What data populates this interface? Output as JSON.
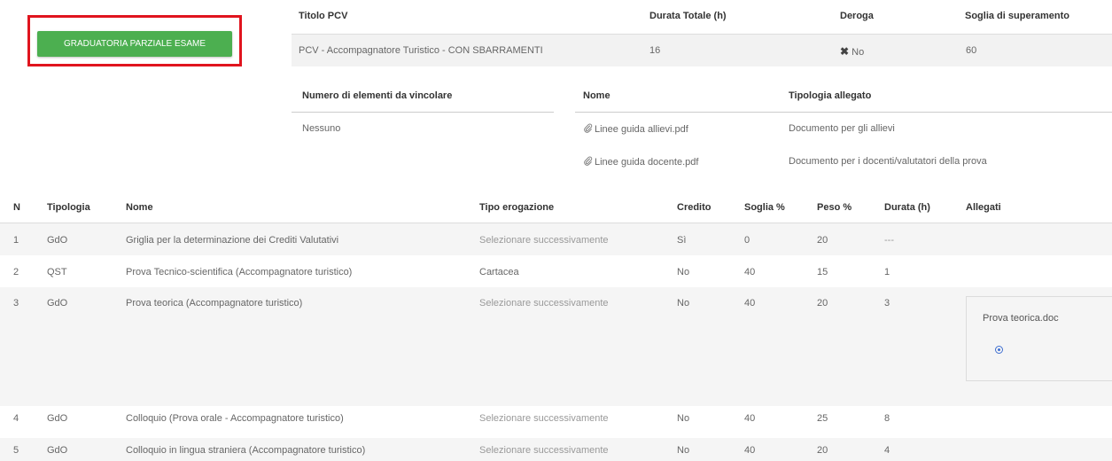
{
  "button": {
    "label": "GRADUATORIA PARZIALE ESAME"
  },
  "pcv": {
    "headers": {
      "title": "Titolo PCV",
      "duration": "Durata Totale (h)",
      "derogation": "Deroga",
      "threshold": "Soglia di superamento"
    },
    "row": {
      "title": "PCV - Accompagnatore Turistico - CON SBARRAMENTI",
      "duration": "16",
      "derogation": "No",
      "threshold": "60"
    }
  },
  "constraints": {
    "header": "Numero di elementi da vincolare",
    "value": "Nessuno"
  },
  "attachments": {
    "headers": {
      "name": "Nome",
      "type": "Tipologia allegato"
    },
    "items": [
      {
        "name": "Linee guida allievi.pdf",
        "type": "Documento per gli allievi"
      },
      {
        "name": "Linee guida docente.pdf",
        "type": "Documento per i docenti/valutatori della prova"
      }
    ]
  },
  "exams": {
    "headers": {
      "n": "N",
      "type": "Tipologia",
      "name": "Nome",
      "delivery": "Tipo erogazione",
      "credit": "Credito",
      "threshold": "Soglia %",
      "weight": "Peso %",
      "duration": "Durata (h)",
      "attachments": "Allegati"
    },
    "rows": [
      {
        "n": "1",
        "type": "GdO",
        "name": "Griglia per la determinazione dei Crediti Valutativi",
        "delivery": "Selezionare successivamente",
        "credit": "Sì",
        "threshold": "0",
        "weight": "20",
        "duration": "---"
      },
      {
        "n": "2",
        "type": "QST",
        "name": "Prova Tecnico-scientifica (Accompagnatore turistico)",
        "delivery": "Cartacea",
        "credit": "No",
        "threshold": "40",
        "weight": "15",
        "duration": "1"
      },
      {
        "n": "3",
        "type": "GdO",
        "name": "Prova teorica (Accompagnatore turistico)",
        "delivery": "Selezionare successivamente",
        "credit": "No",
        "threshold": "40",
        "weight": "20",
        "duration": "3",
        "attachment": "Prova teorica.doc"
      },
      {
        "n": "4",
        "type": "GdO",
        "name": "Colloquio (Prova orale - Accompagnatore turistico)",
        "delivery": "Selezionare successivamente",
        "credit": "No",
        "threshold": "40",
        "weight": "25",
        "duration": "8"
      },
      {
        "n": "5",
        "type": "GdO",
        "name": "Colloquio in lingua straniera (Accompagnatore turistico)",
        "delivery": "Selezionare successivamente",
        "credit": "No",
        "threshold": "40",
        "weight": "20",
        "duration": "4"
      }
    ]
  },
  "icons": {
    "derogation": "close-x-icon",
    "attachment": "paperclip-icon",
    "attach-action": "circle-dot-icon"
  },
  "colors": {
    "button": "#4caf50",
    "highlight": "#e0141e",
    "link": "#3f6fd1"
  }
}
